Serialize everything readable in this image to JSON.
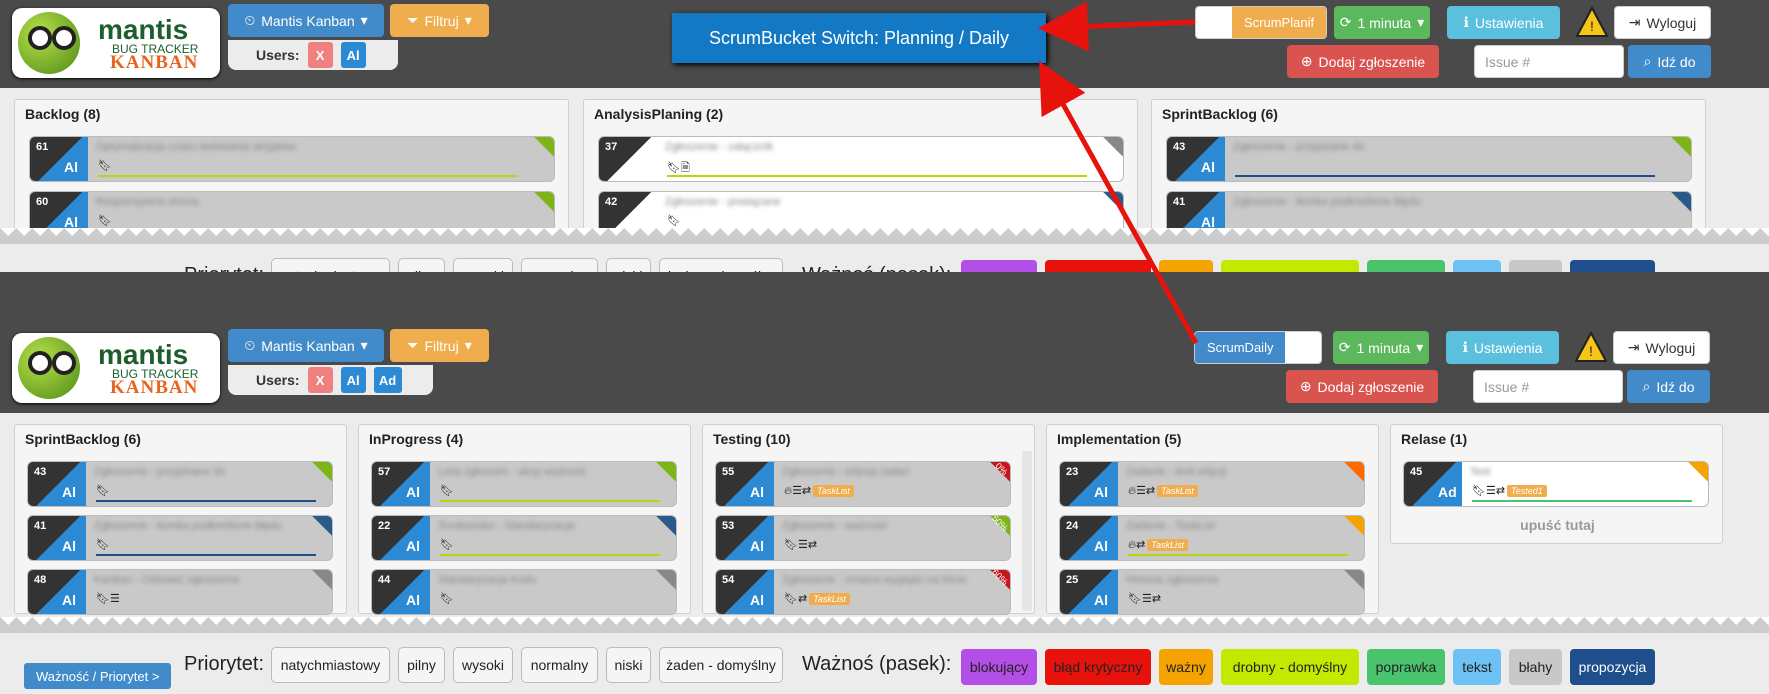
{
  "callout": "ScrumBucket Switch: Planning / Daily",
  "top": {
    "board_label": "Mantis Kanban",
    "filter_label": "Filtruj",
    "users_label": "Users:",
    "user_x": "X",
    "user_al": "Al",
    "user_ad": "Ad",
    "scrum_planif": "ScrumPlanif",
    "scrum_daily": "ScrumDaily",
    "refresh_label": "1 minuta",
    "settings_label": "Ustawienia",
    "logout_label": "Wyloguj",
    "add_issue_label": "Dodaj zgłoszenie",
    "issue_placeholder": "Issue #",
    "goto_label": "Idź do"
  },
  "logo": {
    "title": "mantis",
    "subtitle": "BUG TRACKER",
    "sub2": "KANBAN"
  },
  "panelA": {
    "columns": [
      {
        "title": "Backlog (8)",
        "cards": [
          {
            "id": "61",
            "avatar": "Al",
            "text": "Optymalizacja czasu ładowania skryptów"
          },
          {
            "id": "60",
            "avatar": "Al",
            "text": "Responsywna strona"
          }
        ]
      },
      {
        "title": "AnalysisPlaning (2)",
        "cards": [
          {
            "id": "37",
            "avatar": "",
            "text": "Zgłoszenie - załącznik"
          },
          {
            "id": "42",
            "avatar": "",
            "text": "Zgłoszenie - powiązane"
          }
        ]
      },
      {
        "title": "SprintBacklog (6)",
        "cards": [
          {
            "id": "43",
            "avatar": "Al",
            "text": "Zgłoszenie - przypisane do"
          },
          {
            "id": "41",
            "avatar": "Al",
            "text": "Zgłoszenie - ikonka podkreślone błędu"
          }
        ]
      }
    ]
  },
  "panelB": {
    "columns": [
      {
        "title": "SprintBacklog (6)",
        "cards": [
          {
            "id": "43",
            "avatar": "Al",
            "text": "Zgłoszenie - przypisane do"
          },
          {
            "id": "41",
            "avatar": "Al",
            "text": "Zgłoszenie - ikonka podkreślone błędu"
          },
          {
            "id": "48",
            "avatar": "Al",
            "text": "Kanban - Odśwież zgłoszenia"
          }
        ]
      },
      {
        "title": "InProgress (4)",
        "cards": [
          {
            "id": "57",
            "avatar": "Al",
            "text": "Lista zgłoszeń - ukryj ważność"
          },
          {
            "id": "22",
            "avatar": "Al",
            "text": "Środowisko - Standaryzacja"
          },
          {
            "id": "44",
            "avatar": "Al",
            "text": "Standaryzacja Kodu"
          }
        ]
      },
      {
        "title": "Testing (10)",
        "cards": [
          {
            "id": "55",
            "avatar": "Al",
            "text": "Zgłoszenie - edycja zadań",
            "tag": "TaskList",
            "pct": "0%"
          },
          {
            "id": "53",
            "avatar": "Al",
            "text": "Zgłoszenie - ważność",
            "pct": "50%"
          },
          {
            "id": "54",
            "avatar": "Al",
            "text": "Zgłoszenie - zmiana wyglądu na liście",
            "tag": "TaskList",
            "pct": "60%"
          }
        ]
      },
      {
        "title": "Implementation (5)",
        "cards": [
          {
            "id": "23",
            "avatar": "Al",
            "text": "Zadanie - limit edycji",
            "tag": "TaskList"
          },
          {
            "id": "24",
            "avatar": "Al",
            "text": "Zadanie - TaskList",
            "tag": "TaskList"
          },
          {
            "id": "25",
            "avatar": "Al",
            "text": "Historia zgłoszenia"
          }
        ]
      },
      {
        "title": "Relase (1)",
        "cards": [
          {
            "id": "45",
            "avatar": "Ad",
            "text": "Test",
            "tag": "Tested1"
          }
        ],
        "drop": "upuść tutaj"
      }
    ]
  },
  "legend": {
    "toggle": "Ważność / Priorytet >",
    "priority_label": "Priorytet:",
    "priorities": [
      "natychmiastowy",
      "pilny",
      "wysoki",
      "normalny",
      "niski",
      "żaden  - domyślny"
    ],
    "severity_label": "Ważnoś (pasek):",
    "severities": [
      "blokujący",
      "błąd krytyczny",
      "ważny",
      "drobny  - domyślny",
      "poprawka",
      "tekst",
      "błahy",
      "propozycja"
    ]
  },
  "colors": {
    "accent": "#428bca",
    "callout": "#1479c4",
    "arrow": "#e8120c"
  }
}
